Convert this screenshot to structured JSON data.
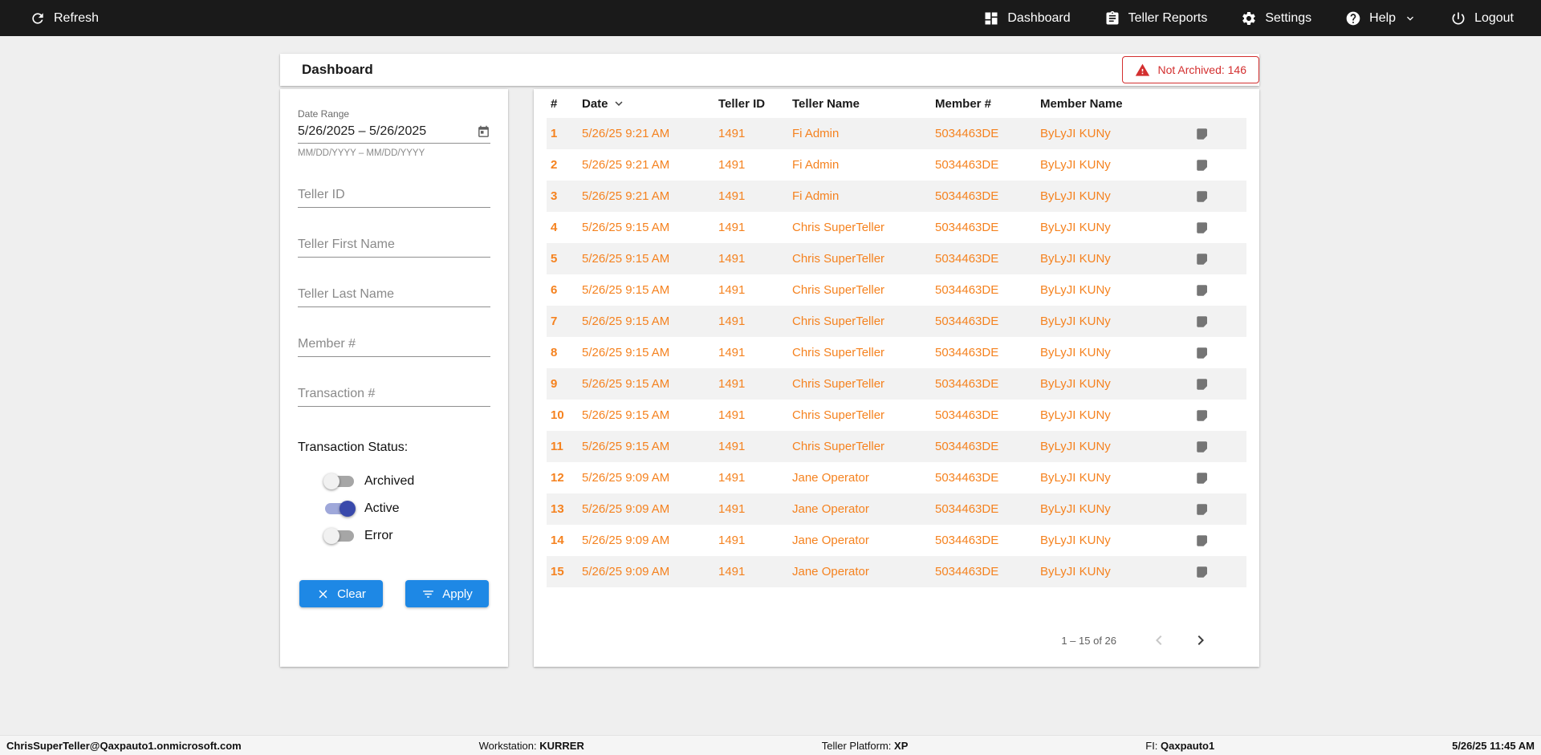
{
  "topbar": {
    "refresh_label": "Refresh",
    "nav": [
      {
        "label": "Dashboard",
        "icon": "dashboard-icon"
      },
      {
        "label": "Teller Reports",
        "icon": "reports-icon"
      },
      {
        "label": "Settings",
        "icon": "settings-icon"
      },
      {
        "label": "Help",
        "icon": "help-icon",
        "has_dropdown": true
      },
      {
        "label": "Logout",
        "icon": "logout-icon"
      }
    ]
  },
  "header": {
    "title": "Dashboard",
    "not_archived_label": "Not Archived: 146"
  },
  "filters": {
    "date_range_label": "Date Range",
    "date_range_value": "5/26/2025 – 5/26/2025",
    "date_range_helper": "MM/DD/YYYY – MM/DD/YYYY",
    "teller_id_placeholder": "Teller ID",
    "teller_first_name_placeholder": "Teller First Name",
    "teller_last_name_placeholder": "Teller Last Name",
    "member_number_placeholder": "Member #",
    "transaction_number_placeholder": "Transaction #",
    "status_label": "Transaction Status:",
    "toggles": [
      {
        "label": "Archived",
        "on": false
      },
      {
        "label": "Active",
        "on": true
      },
      {
        "label": "Error",
        "on": false
      }
    ],
    "clear_label": "Clear",
    "apply_label": "Apply"
  },
  "table": {
    "columns": [
      "#",
      "Date",
      "Teller ID",
      "Teller Name",
      "Member #",
      "Member Name"
    ],
    "sort_column": "Date",
    "sort_direction": "desc",
    "rows": [
      [
        "1",
        "5/26/25 9:21 AM",
        "1491",
        "Fi Admin",
        "5034463DE",
        "ByLyJI KUNy"
      ],
      [
        "2",
        "5/26/25 9:21 AM",
        "1491",
        "Fi Admin",
        "5034463DE",
        "ByLyJI KUNy"
      ],
      [
        "3",
        "5/26/25 9:21 AM",
        "1491",
        "Fi Admin",
        "5034463DE",
        "ByLyJI KUNy"
      ],
      [
        "4",
        "5/26/25 9:15 AM",
        "1491",
        "Chris SuperTeller",
        "5034463DE",
        "ByLyJI KUNy"
      ],
      [
        "5",
        "5/26/25 9:15 AM",
        "1491",
        "Chris SuperTeller",
        "5034463DE",
        "ByLyJI KUNy"
      ],
      [
        "6",
        "5/26/25 9:15 AM",
        "1491",
        "Chris SuperTeller",
        "5034463DE",
        "ByLyJI KUNy"
      ],
      [
        "7",
        "5/26/25 9:15 AM",
        "1491",
        "Chris SuperTeller",
        "5034463DE",
        "ByLyJI KUNy"
      ],
      [
        "8",
        "5/26/25 9:15 AM",
        "1491",
        "Chris SuperTeller",
        "5034463DE",
        "ByLyJI KUNy"
      ],
      [
        "9",
        "5/26/25 9:15 AM",
        "1491",
        "Chris SuperTeller",
        "5034463DE",
        "ByLyJI KUNy"
      ],
      [
        "10",
        "5/26/25 9:15 AM",
        "1491",
        "Chris SuperTeller",
        "5034463DE",
        "ByLyJI KUNy"
      ],
      [
        "11",
        "5/26/25 9:15 AM",
        "1491",
        "Chris SuperTeller",
        "5034463DE",
        "ByLyJI KUNy"
      ],
      [
        "12",
        "5/26/25 9:09 AM",
        "1491",
        "Jane Operator",
        "5034463DE",
        "ByLyJI KUNy"
      ],
      [
        "13",
        "5/26/25 9:09 AM",
        "1491",
        "Jane Operator",
        "5034463DE",
        "ByLyJI KUNy"
      ],
      [
        "14",
        "5/26/25 9:09 AM",
        "1491",
        "Jane Operator",
        "5034463DE",
        "ByLyJI KUNy"
      ],
      [
        "15",
        "5/26/25 9:09 AM",
        "1491",
        "Jane Operator",
        "5034463DE",
        "ByLyJI KUNy"
      ]
    ],
    "pagination_range": "1 – 15 of 26"
  },
  "footer": {
    "user": "ChrisSuperTeller@Qaxpauto1.onmicrosoft.com",
    "workstation_label": "Workstation: ",
    "workstation_value": "KURRER",
    "platform_label": "Teller Platform: ",
    "platform_value": "XP",
    "fi_label": "FI: ",
    "fi_value": "Qaxpauto1",
    "datetime": "5/26/25 11:45 AM"
  },
  "colors": {
    "row_link_orange": "#f5821f",
    "alert_red": "#d32f2f",
    "button_blue": "#1e88e5",
    "toggle_on_blue": "#3949ab",
    "topbar_black": "#1a1a1a"
  }
}
